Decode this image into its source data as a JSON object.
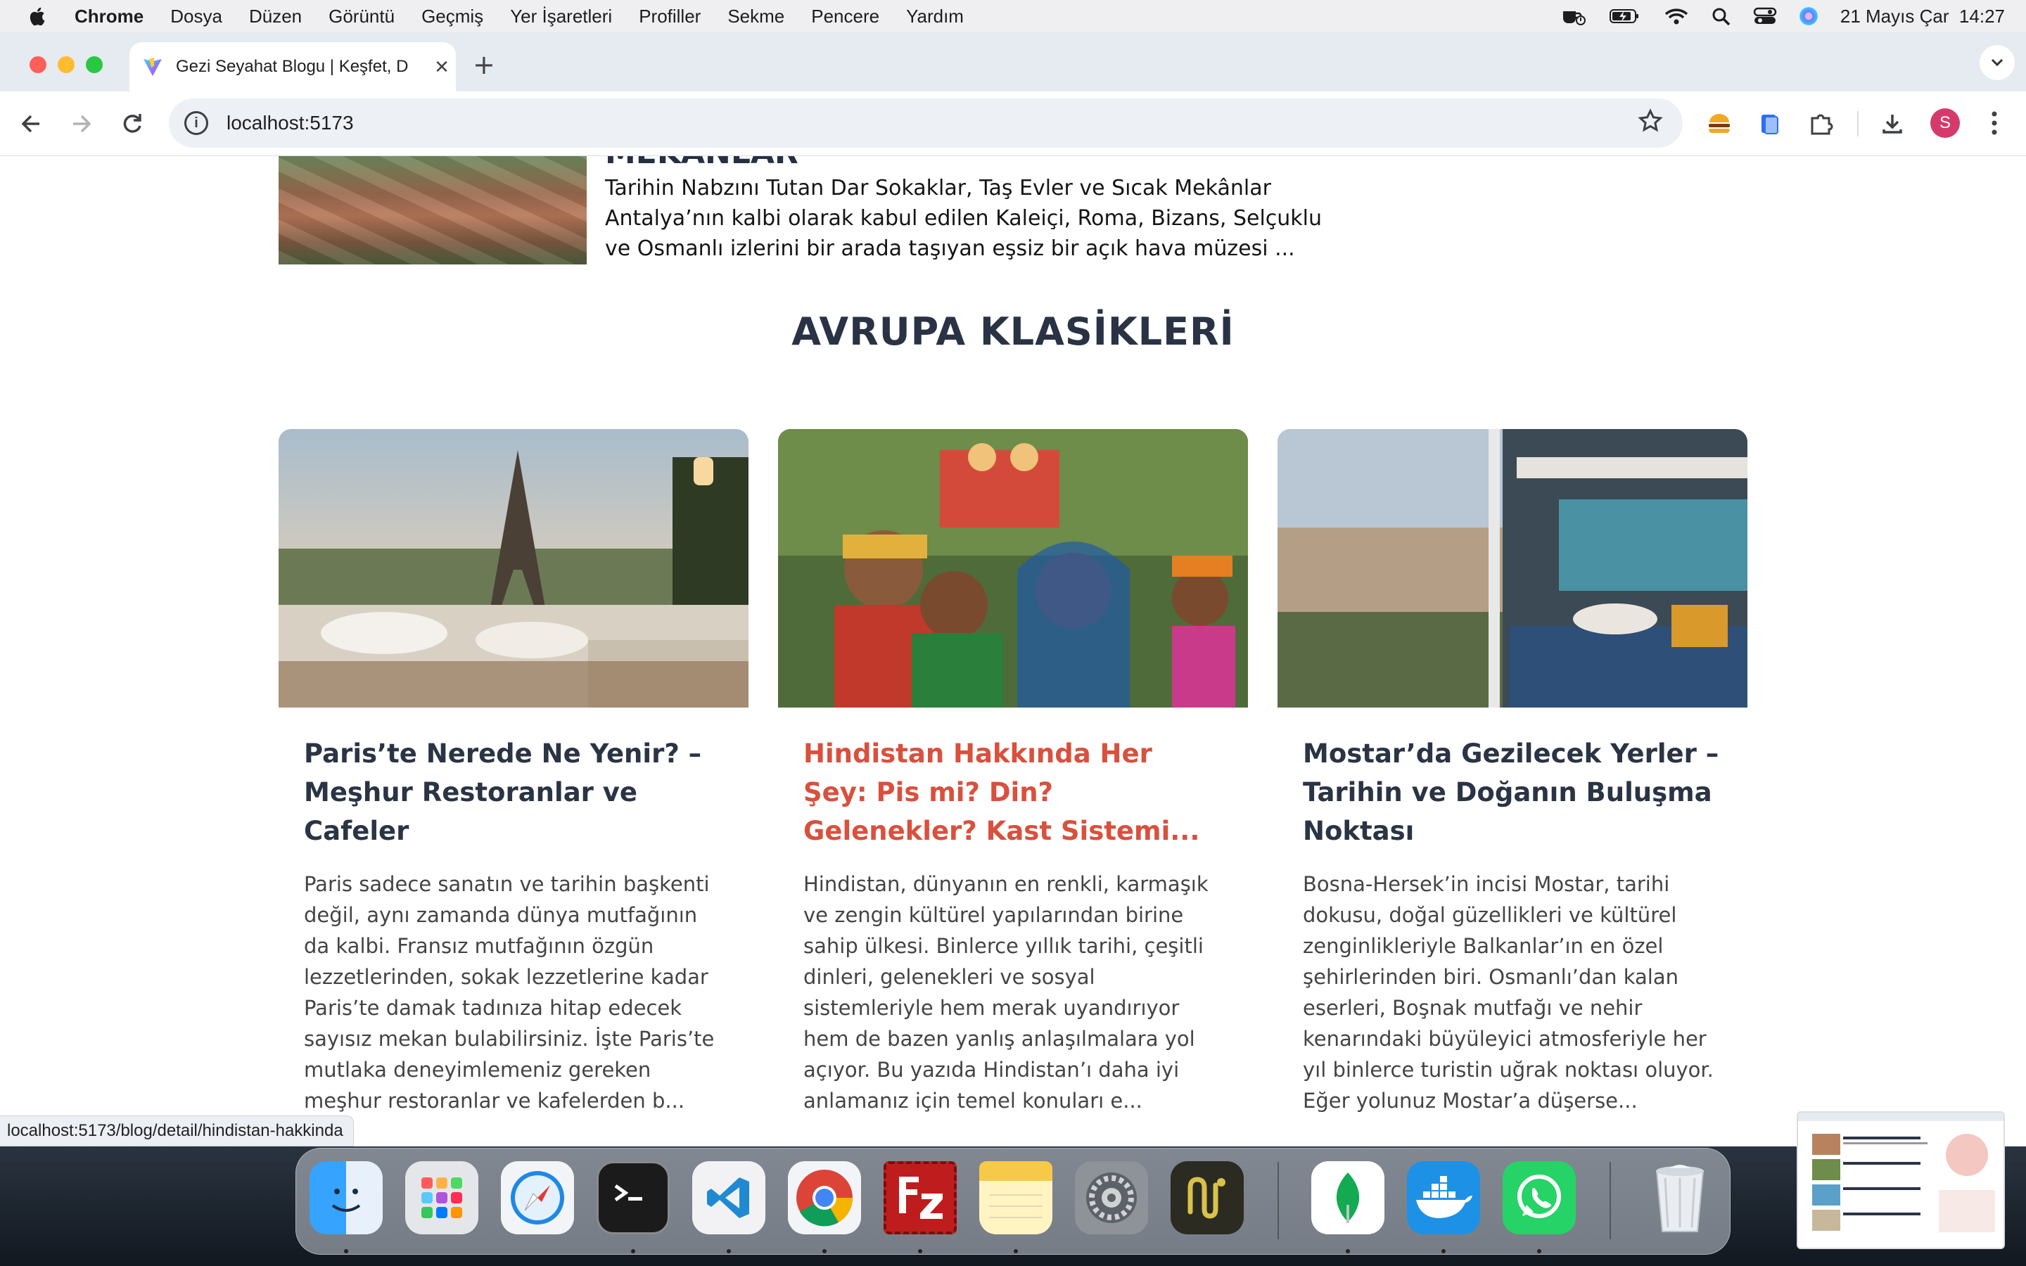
{
  "menubar": {
    "app_name": "Chrome",
    "items": [
      "Dosya",
      "Düzen",
      "Görüntü",
      "Geçmiş",
      "Yer İşaretleri",
      "Profiller",
      "Sekme",
      "Pencere",
      "Yardım"
    ],
    "datetime": "21 Mayıs Çar  14:27"
  },
  "browser": {
    "tab_title": "Gezi Seyahat Blogu | Keşfet, D",
    "new_tab": "+",
    "tab_close": "✕",
    "url": "localhost:5173",
    "profile_initial": "S",
    "status_url": "localhost:5173/blog/detail/hindistan-hakkinda"
  },
  "page": {
    "previous_post": {
      "title_cut": "MEKANLAR",
      "description": "Tarihin Nabzını Tutan Dar Sokaklar, Taş Evler ve Sıcak Mekânlar Antalya’nın kalbi olarak kabul edilen Kaleiçi, Roma, Bizans, Selçuklu ve Osmanlı izlerini bir arada taşıyan eşsiz bir açık hava müzesi ..."
    },
    "section_title": "AVRUPA KLASİKLERİ",
    "cards": [
      {
        "title": "Paris’te Nerede Ne Yenir? – Meşhur Restoranlar ve Cafeler",
        "excerpt": "Paris sadece sanatın ve tarihin başkenti değil, aynı zamanda dünya mutfağının da kalbi. Fransız mutfağının özgün lezzetlerinden, sokak lezzetlerine kadar Paris’te damak tadınıza hitap edecek sayısız mekan bulabilirsiniz. İşte Paris’te mutlaka deneyimlemeniz gereken meşhur restoranlar ve kafelerden b..."
      },
      {
        "title": "Hindistan Hakkında Her Şey: Pis mi? Din? Gelenekler? Kast Sistemi...",
        "excerpt": "Hindistan, dünyanın en renkli, karmaşık ve zengin kültürel yapılarından birine sahip ülkesi. Binlerce yıllık tarihi, çeşitli dinleri, gelenekleri ve sosyal sistemleriyle hem merak uyandırıyor hem de bazen yanlış anlaşılmalara yol açıyor. Bu yazıda Hindistan’ı daha iyi anlamanız için temel konuları e..."
      },
      {
        "title": "Mostar’da Gezilecek Yerler – Tarihin ve Doğanın Buluşma Noktası",
        "excerpt": "Bosna-Hersek’in incisi Mostar, tarihi dokusu, doğal güzellikleri ve kültürel zenginlikleriyle Balkanlar’ın en özel şehirlerinden biri. Osmanlı’dan kalan eserleri, Boşnak mutfağı ve nehir kenarındaki büyüleyici atmosferiyle her yıl binlerce turistin uğrak noktası oluyor. Eğer yolunuz Mostar’a düşerse..."
      }
    ]
  },
  "colors": {
    "heading": "#2b3445",
    "hover_title": "#d9503d",
    "text": "#444444"
  },
  "dock": {
    "apps": [
      "finder-icon",
      "launchpad-icon",
      "safari-icon",
      "terminal-icon",
      "vscode-icon",
      "chrome-icon",
      "filezilla-icon",
      "notes-icon",
      "system-settings-icon",
      "navicat-icon",
      "mongodb-compass-icon",
      "docker-icon",
      "whatsapp-icon",
      "trash-icon"
    ]
  }
}
